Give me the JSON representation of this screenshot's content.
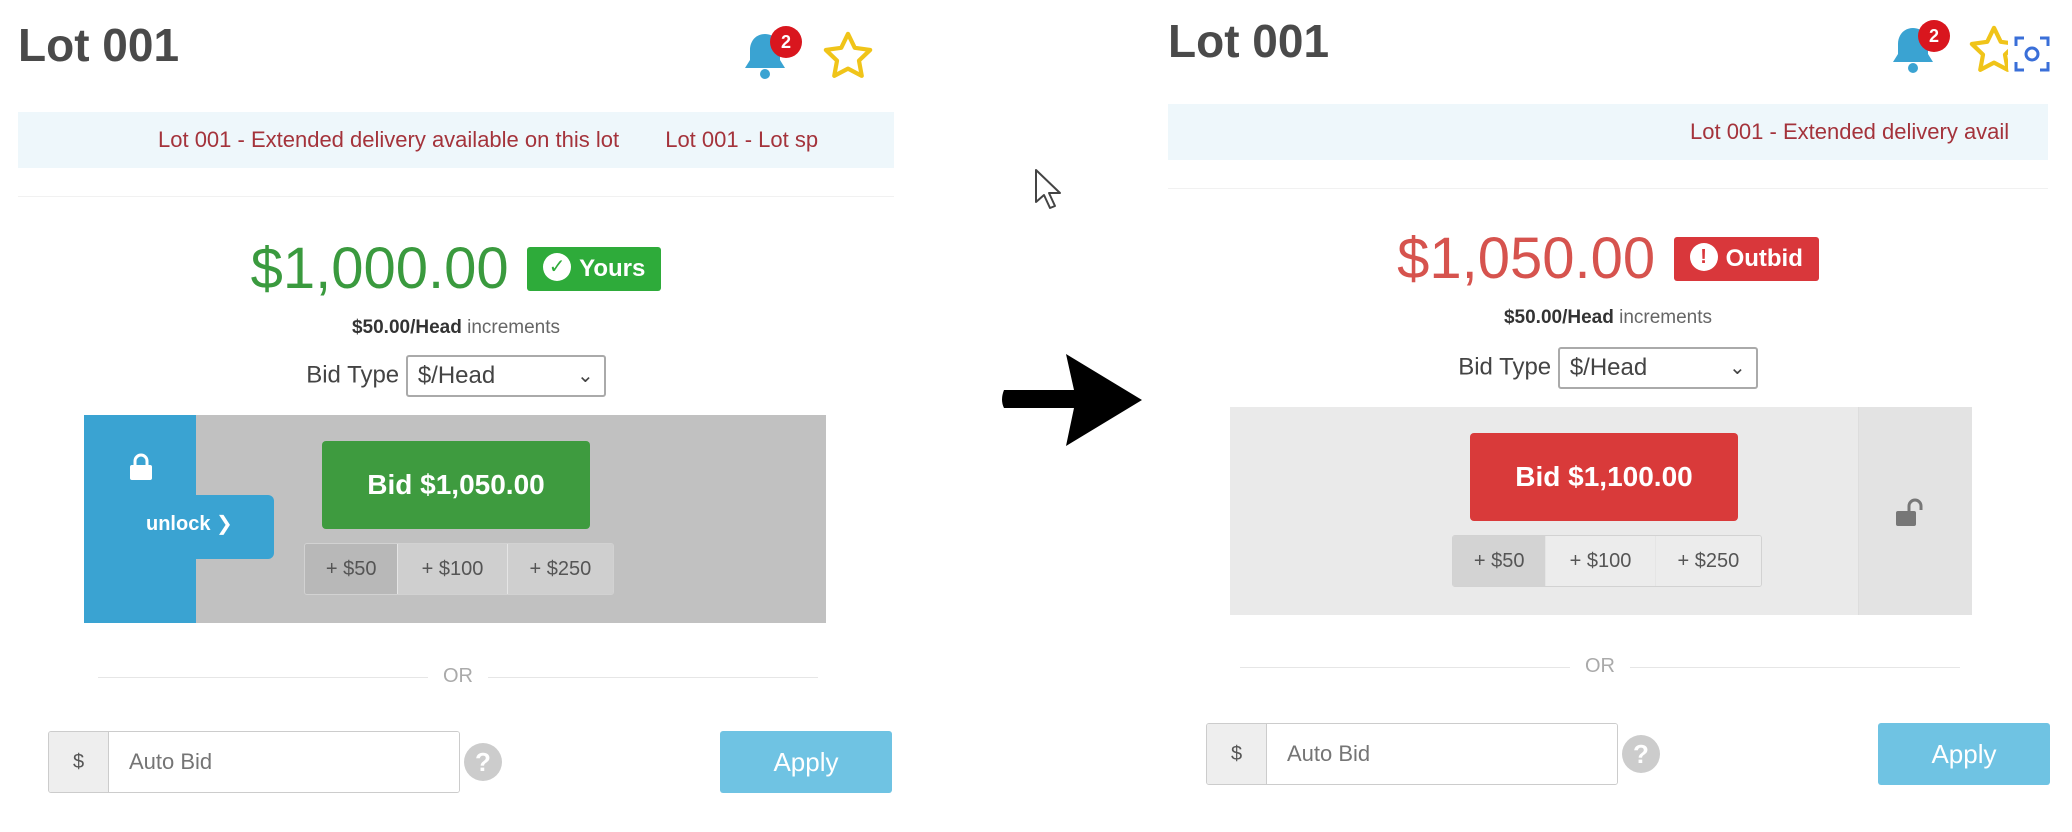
{
  "left": {
    "lot_title": "Lot 001",
    "notification_count": "2",
    "ticker": [
      "Lot 001 - Extended delivery available on this lot",
      "Lot 001 - Lot sp"
    ],
    "price": "$1,000.00",
    "status": "Yours",
    "status_color": "#2eab3a",
    "increment_amount": "$50.00/Head",
    "increment_suffix": " increments",
    "bid_type_label": "Bid Type",
    "bid_type_value": "$/Head",
    "unlock_label": "unlock ❯",
    "bid_button": "Bid $1,050.00",
    "increments": [
      "+ $50",
      "+ $100",
      "+ $250"
    ],
    "or_text": "OR",
    "currency_addon": "$",
    "auto_bid_placeholder": "Auto Bid",
    "apply_label": "Apply"
  },
  "right": {
    "lot_title": "Lot 001",
    "notification_count": "2",
    "ticker": [
      "Lot 001 - Extended delivery avail"
    ],
    "price": "$1,050.00",
    "status": "Outbid",
    "status_color": "#d9373b",
    "increment_amount": "$50.00/Head",
    "increment_suffix": " increments",
    "bid_type_label": "Bid Type",
    "bid_type_value": "$/Head",
    "bid_button": "Bid $1,100.00",
    "increments": [
      "+ $50",
      "+ $100",
      "+ $250"
    ],
    "or_text": "OR",
    "currency_addon": "$",
    "auto_bid_placeholder": "Auto Bid",
    "apply_label": "Apply"
  },
  "colors": {
    "accent_blue": "#3aa3d2",
    "bid_green": "#3e9b3f",
    "bid_red": "#d93a3a",
    "ticker_text": "#a4333b",
    "apply": "#6fc3e3"
  }
}
